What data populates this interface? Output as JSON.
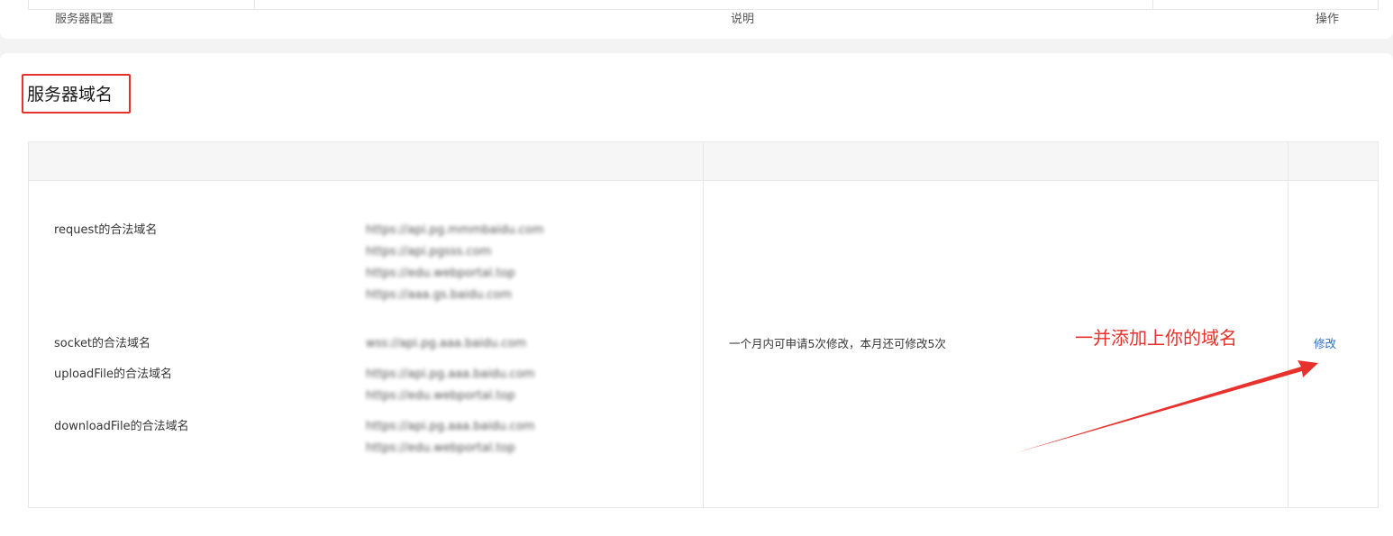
{
  "section": {
    "title": "服务器域名"
  },
  "table": {
    "headers": {
      "config": "服务器配置",
      "description": "说明",
      "action": "操作"
    },
    "rows": [
      {
        "label": "request的合法域名",
        "domains": [
          "https://api.pg.mmmbaidu.com",
          "https://api.pgsss.com",
          "https://edu.webportal.top",
          "https://aaa.gs.baidu.com"
        ]
      },
      {
        "label": "socket的合法域名",
        "domains": [
          "wss://api.pg.aaa.baidu.com"
        ]
      },
      {
        "label": "uploadFile的合法域名",
        "domains": [
          "https://api.pg.aaa.baidu.com",
          "https://edu.webportal.top"
        ]
      },
      {
        "label": "downloadFile的合法域名",
        "domains": [
          "https://api.pg.aaa.baidu.com",
          "https://edu.webportal.top"
        ]
      }
    ],
    "description": "一个月内可申请5次修改，本月还可修改5次",
    "action_label": "修改"
  },
  "annotation": {
    "text": "一并添加上你的域名",
    "color": "#e6312c"
  },
  "colors": {
    "link": "#2f6bbf",
    "border": "#e7e7eb",
    "header_bg": "#f6f6f6",
    "highlight": "#e6312c"
  }
}
